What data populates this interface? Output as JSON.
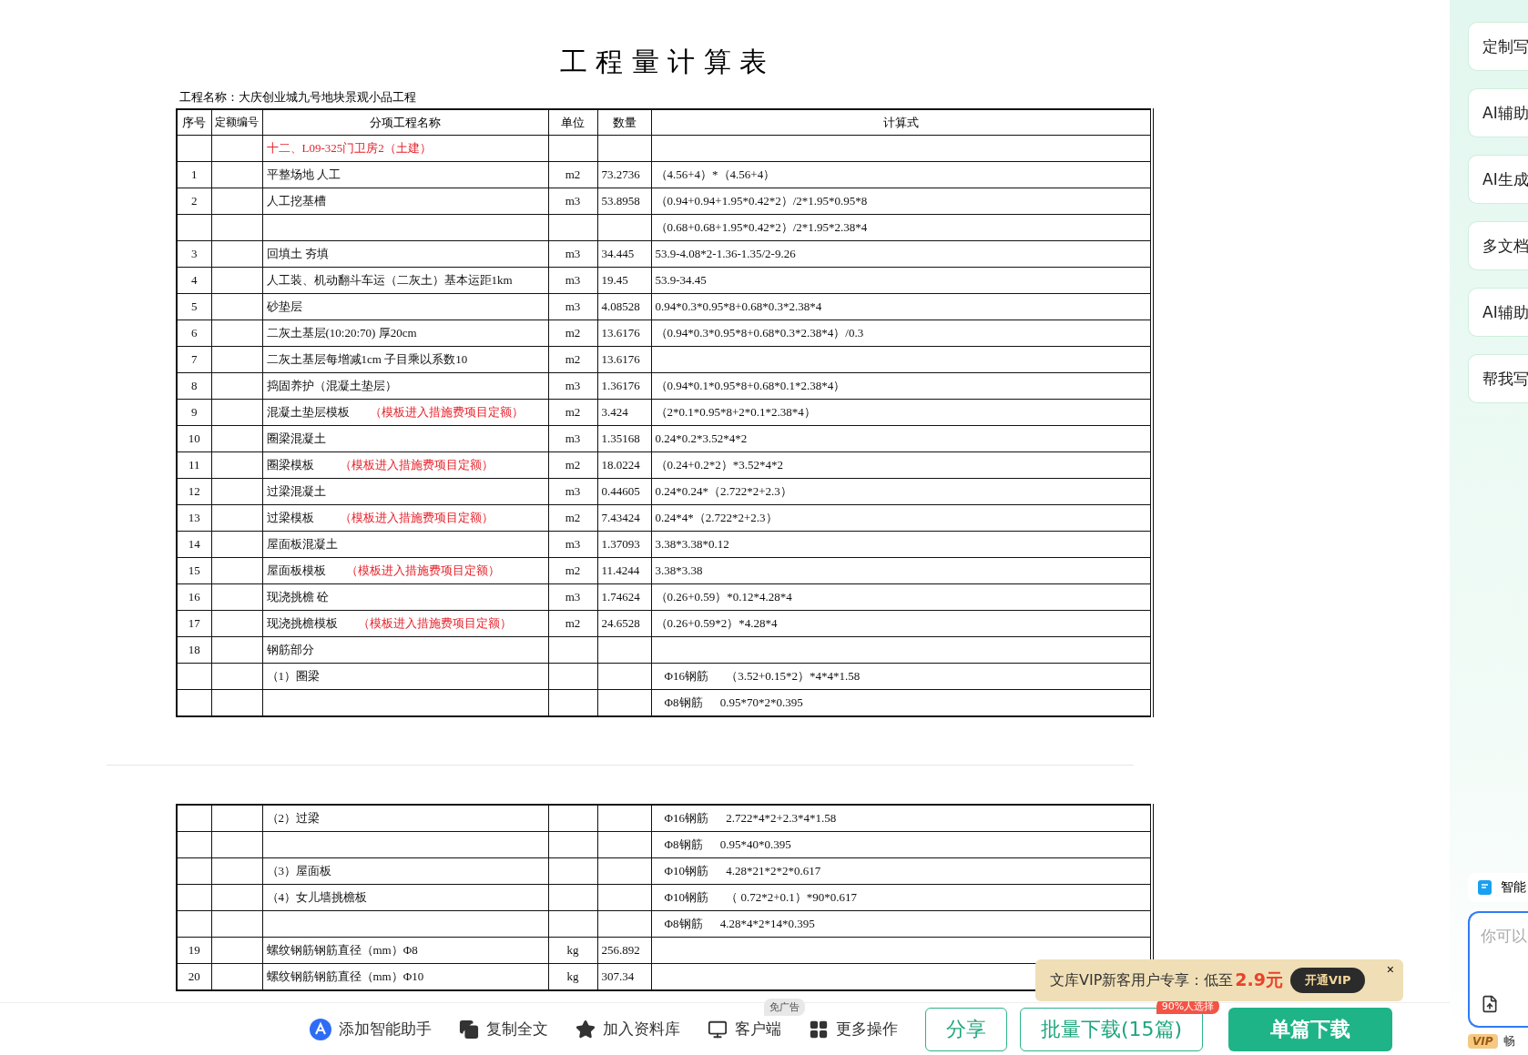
{
  "document": {
    "title": "工 程 量 计 算 表",
    "project": "工程名称：大庆创业城九号地块景观小品工程",
    "columns": [
      "序号",
      "定额编号",
      "分项工程名称",
      "单位",
      "数量",
      "计算式"
    ],
    "pages": [
      {
        "rows": [
          {
            "kind": "section",
            "name": "十二、L09-325门卫房2（土建）"
          },
          {
            "kind": "item",
            "no": "1",
            "name": "平整场地 人工",
            "unit": "m2",
            "qty": "73.2736",
            "formula": "（4.56+4）*（4.56+4）"
          },
          {
            "kind": "item",
            "no": "2",
            "name": "人工挖基槽",
            "unit": "m3",
            "qty": "53.8958",
            "formula": "（0.94+0.94+1.95*0.42*2）/2*1.95*0.95*8"
          },
          {
            "kind": "item",
            "formula": "（0.68+0.68+1.95*0.42*2）/2*1.95*2.38*4"
          },
          {
            "kind": "item",
            "no": "3",
            "name": "回填土 夯填",
            "unit": "m3",
            "qty": "34.445",
            "formula": "53.9-4.08*2-1.36-1.35/2-9.26"
          },
          {
            "kind": "item",
            "no": "4",
            "name": "人工装、机动翻斗车运（二灰土）基本运距1km",
            "unit": "m3",
            "qty": "19.45",
            "formula": "53.9-34.45"
          },
          {
            "kind": "item",
            "no": "5",
            "name": "砂垫层",
            "unit": "m3",
            "qty": "4.08528",
            "formula": "0.94*0.3*0.95*8+0.68*0.3*2.38*4"
          },
          {
            "kind": "item",
            "no": "6",
            "name": "二灰土基层(10:20:70) 厚20cm",
            "unit": "m2",
            "qty": "13.6176",
            "formula": "（0.94*0.3*0.95*8+0.68*0.3*2.38*4）/0.3"
          },
          {
            "kind": "item",
            "no": "7",
            "name": "二灰土基层每增减1cm 子目乘以系数10",
            "unit": "m2",
            "qty": "13.6176"
          },
          {
            "kind": "item",
            "no": "8",
            "name": "捣固养护（混凝土垫层）",
            "unit": "m3",
            "qty": "1.36176",
            "formula": "（0.94*0.1*0.95*8+0.68*0.1*2.38*4）"
          },
          {
            "kind": "item",
            "no": "9",
            "name": "混凝土垫层模板",
            "note": "（模板进入措施费项目定额）",
            "unit": "m2",
            "qty": "3.424",
            "formula": "（2*0.1*0.95*8+2*0.1*2.38*4）"
          },
          {
            "kind": "item",
            "no": "10",
            "name": "圈梁混凝土",
            "unit": "m3",
            "qty": "1.35168",
            "formula": "0.24*0.2*3.52*4*2"
          },
          {
            "kind": "item",
            "no": "11",
            "name": "圈梁模板",
            "note": "（模板进入措施费项目定额）",
            "unit": "m2",
            "qty": "18.0224",
            "formula": "（0.24+0.2*2）*3.52*4*2"
          },
          {
            "kind": "item",
            "no": "12",
            "name": "过梁混凝土",
            "unit": "m3",
            "qty": "0.44605",
            "formula": "0.24*0.24*（2.722*2+2.3）"
          },
          {
            "kind": "item",
            "no": "13",
            "name": "过梁模板",
            "note": "（模板进入措施费项目定额）",
            "unit": "m2",
            "qty": "7.43424",
            "formula": "0.24*4*（2.722*2+2.3）"
          },
          {
            "kind": "item",
            "no": "14",
            "name": "屋面板混凝土",
            "unit": "m3",
            "qty": "1.37093",
            "formula": "3.38*3.38*0.12"
          },
          {
            "kind": "item",
            "no": "15",
            "name": "屋面板模板",
            "note": "（模板进入措施费项目定额）",
            "unit": "m2",
            "qty": "11.4244",
            "formula": "3.38*3.38"
          },
          {
            "kind": "item",
            "no": "16",
            "name": "现浇挑檐 砼",
            "unit": "m3",
            "qty": "1.74624",
            "formula": "（0.26+0.59）*0.12*4.28*4"
          },
          {
            "kind": "item",
            "no": "17",
            "name": "现浇挑檐模板",
            "note": "（模板进入措施费项目定额）",
            "unit": "m2",
            "qty": "24.6528",
            "formula": "（0.26+0.59*2）*4.28*4"
          },
          {
            "kind": "item",
            "no": "18",
            "name": "钢筋部分"
          },
          {
            "kind": "item",
            "name": "（1）圈梁",
            "rebar": "Φ16钢筋",
            "formula": "（3.52+0.15*2）*4*4*1.58"
          },
          {
            "kind": "item",
            "rebar": "Φ8钢筋",
            "formula": "0.95*70*2*0.395"
          }
        ]
      },
      {
        "rows": [
          {
            "kind": "item",
            "name": "（2）过梁",
            "rebar": "Φ16钢筋",
            "formula": "2.722*4*2+2.3*4*1.58"
          },
          {
            "kind": "item",
            "rebar": "Φ8钢筋",
            "formula": "0.95*40*0.395"
          },
          {
            "kind": "item",
            "name": "（3）屋面板",
            "rebar": "Φ10钢筋",
            "formula": "4.28*21*2*2*0.617"
          },
          {
            "kind": "item",
            "name": "（4）女儿墙挑檐板",
            "rebar": "Φ10钢筋",
            "formula": "（ 0.72*2+0.1）*90*0.617"
          },
          {
            "kind": "item",
            "rebar": "Φ8钢筋",
            "formula": "4.28*4*2*14*0.395"
          },
          {
            "kind": "item",
            "no": "19",
            "name": "螺纹钢筋钢筋直径（mm）Φ8",
            "unit": "kg",
            "qty": "256.892"
          },
          {
            "kind": "item",
            "no": "20",
            "name": "螺纹钢筋钢筋直径（mm）Φ10",
            "unit": "kg",
            "qty": "307.34"
          }
        ]
      }
    ]
  },
  "promo": {
    "text": "文库VIP新客用户专享：低至",
    "price": "2.9元",
    "button": "开通VIP",
    "close": "×"
  },
  "toolbar": {
    "actions": [
      {
        "kind": "assistant",
        "label": "添加智能助手"
      },
      {
        "kind": "copy",
        "label": "复制全文"
      },
      {
        "kind": "star",
        "label": "加入资料库"
      },
      {
        "kind": "desktop",
        "label": "客户端",
        "badge": "免广告"
      },
      {
        "kind": "grid",
        "label": "更多操作"
      }
    ],
    "share": "分享",
    "batch": "批量下载(15篇)",
    "batch_badge": "90%人选择",
    "single": "单篇下载"
  },
  "sidebar": {
    "items": [
      "定制写",
      "AI辅助",
      "AI生成",
      "多文档",
      "AI辅助",
      "帮我写"
    ],
    "assistant": "智能",
    "input_placeholder": "你可以",
    "vip_badge": "VIP",
    "vip_text": "畅"
  }
}
